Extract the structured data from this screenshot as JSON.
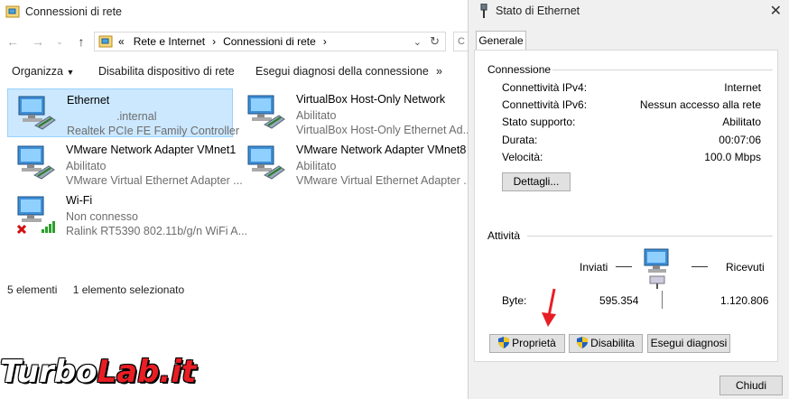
{
  "explorer": {
    "title": "Connessioni di rete",
    "breadcrumb": [
      "«",
      "Rete e Internet",
      "Connessioni di rete"
    ],
    "search_label": "C",
    "toolbar": {
      "organize": "Organizza",
      "disable": "Disabilita dispositivo di rete",
      "diagnose": "Esegui diagnosi della connessione",
      "more": "»"
    },
    "items": [
      {
        "name": "Ethernet",
        "status": ".internal",
        "device": "Realtek PCIe FE Family Controller"
      },
      {
        "name": "VirtualBox Host-Only Network",
        "status": "Abilitato",
        "device": "VirtualBox Host-Only Ethernet Ad..."
      },
      {
        "name": "VMware Network Adapter VMnet1",
        "status": "Abilitato",
        "device": "VMware Virtual Ethernet Adapter ..."
      },
      {
        "name": "VMware Network Adapter VMnet8",
        "status": "Abilitato",
        "device": "VMware Virtual Ethernet Adapter ..."
      },
      {
        "name": "Wi-Fi",
        "status": "Non connesso",
        "device": "Ralink RT5390 802.11b/g/n WiFi A..."
      }
    ],
    "status": {
      "count": "5 elementi",
      "selected": "1 elemento selezionato"
    }
  },
  "dialog": {
    "title": "Stato di Ethernet",
    "tab": "Generale",
    "connection_label": "Connessione",
    "rows": [
      {
        "label": "Connettività IPv4:",
        "value": "Internet"
      },
      {
        "label": "Connettività IPv6:",
        "value": "Nessun accesso alla rete"
      },
      {
        "label": "Stato supporto:",
        "value": "Abilitato"
      },
      {
        "label": "Durata:",
        "value": "00:07:06"
      },
      {
        "label": "Velocità:",
        "value": "100.0 Mbps"
      }
    ],
    "details_button": "Dettagli...",
    "activity_label": "Attività",
    "sent_label": "Inviati",
    "received_label": "Ricevuti",
    "bytes_label": "Byte:",
    "bytes_sent": "595.354",
    "bytes_received": "1.120.806",
    "properties_button": "Proprietà",
    "disable_button": "Disabilita",
    "diagnose_button": "Esegui diagnosi",
    "close_button": "Chiudi"
  },
  "watermark": {
    "part1": "Turbo",
    "part2": "Lab.it"
  },
  "colors": {
    "selection": "#cce8ff",
    "accent_red": "#e81e24",
    "dialog_bg": "#f0f0f0"
  }
}
